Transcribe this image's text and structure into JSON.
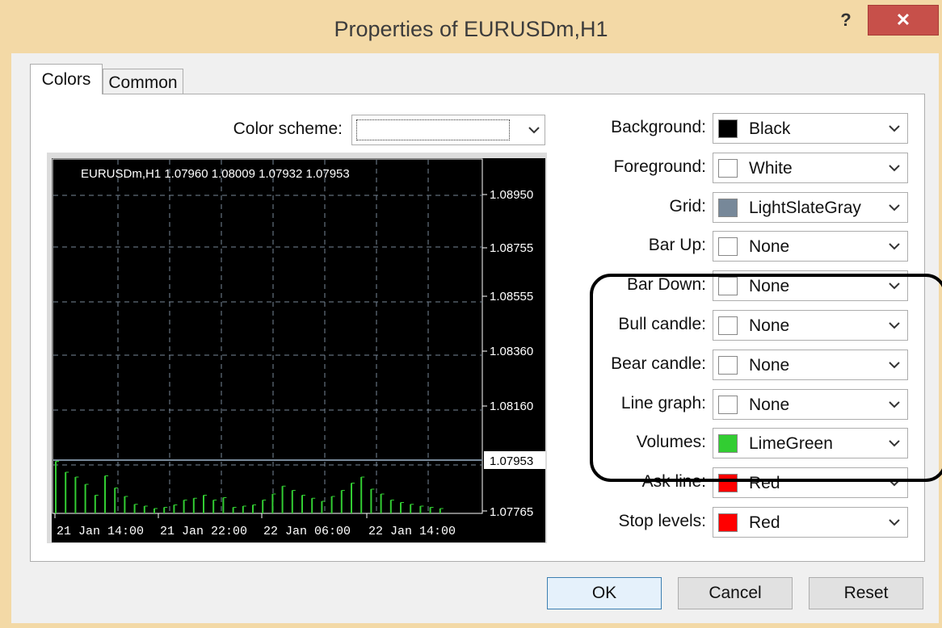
{
  "window": {
    "title": "Properties of EURUSDm,H1",
    "help_label": "?",
    "close_label": "✕"
  },
  "tabs": [
    {
      "label": "Colors",
      "active": true
    },
    {
      "label": "Common",
      "active": false
    }
  ],
  "color_scheme": {
    "label": "Color scheme:",
    "value": ""
  },
  "color_rows": [
    {
      "label": "Background:",
      "value": "Black",
      "swatch": "#000000"
    },
    {
      "label": "Foreground:",
      "value": "White",
      "swatch": "#ffffff"
    },
    {
      "label": "Grid:",
      "value": "LightSlateGray",
      "swatch": "#778899"
    },
    {
      "label": "Bar Up:",
      "value": "None",
      "swatch": "#ffffff"
    },
    {
      "label": "Bar Down:",
      "value": "None",
      "swatch": "#ffffff"
    },
    {
      "label": "Bull candle:",
      "value": "None",
      "swatch": "#ffffff"
    },
    {
      "label": "Bear candle:",
      "value": "None",
      "swatch": "#ffffff"
    },
    {
      "label": "Line graph:",
      "value": "None",
      "swatch": "#ffffff"
    },
    {
      "label": "Volumes:",
      "value": "LimeGreen",
      "swatch": "#32cd32"
    },
    {
      "label": "Ask line:",
      "value": "Red",
      "swatch": "#ff0000"
    },
    {
      "label": "Stop levels:",
      "value": "Red",
      "swatch": "#ff0000"
    }
  ],
  "chart_preview": {
    "header": "EURUSDm,H1  1.07960 1.08009 1.07932 1.07953",
    "price_labels": [
      "1.08950",
      "1.08755",
      "1.08555",
      "1.08360",
      "1.08160"
    ],
    "current_price": "1.07953",
    "bottom_price": "1.07765",
    "time_labels": [
      "21 Jan 14:00",
      "21 Jan 22:00",
      "22 Jan 06:00",
      "22 Jan 14:00"
    ],
    "volumes": [
      0.86,
      0.68,
      0.6,
      0.48,
      0.3,
      0.62,
      0.42,
      0.28,
      0.15,
      0.12,
      0.08,
      0.1,
      0.14,
      0.22,
      0.25,
      0.3,
      0.22,
      0.26,
      0.1,
      0.12,
      0.14,
      0.22,
      0.32,
      0.45,
      0.38,
      0.3,
      0.25,
      0.2,
      0.28,
      0.38,
      0.5,
      0.6,
      0.4,
      0.32,
      0.22,
      0.18,
      0.15,
      0.12,
      0.1,
      0.08
    ],
    "colors": {
      "background": "#000000",
      "foreground": "#ffffff",
      "grid": "#778899",
      "volumes": "#32cd32"
    }
  },
  "buttons": {
    "ok": "OK",
    "cancel": "Cancel",
    "reset": "Reset"
  }
}
